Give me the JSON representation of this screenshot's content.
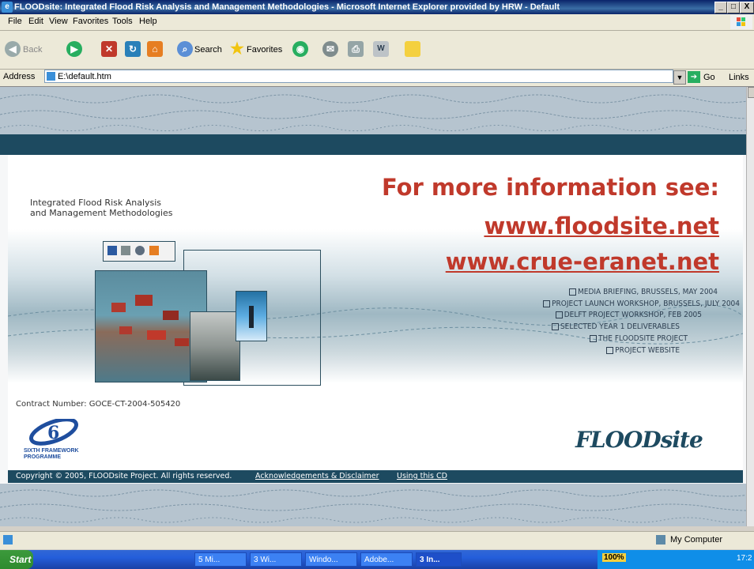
{
  "window": {
    "title": "FLOODsite: Integrated Flood Risk Analysis and Management Methodologies - Microsoft Internet Explorer provided by HRW - Default",
    "minimize": "_",
    "maximize": "□",
    "close": "X"
  },
  "menu": [
    "File",
    "Edit",
    "View",
    "Favorites",
    "Tools",
    "Help"
  ],
  "toolbar": {
    "back": "Back",
    "search": "Search",
    "favorites": "Favorites"
  },
  "address": {
    "label": "Address",
    "value": "E:\\default.htm",
    "go": "Go",
    "links": "Links"
  },
  "page": {
    "subtitle_line1": "Integrated Flood Risk Analysis",
    "subtitle_line2": "and Management Methodologies",
    "info_heading": "For more information see:",
    "link1": "www.floodsite.net",
    "link2": "www.crue-eranet.net",
    "nav_links": [
      "MEDIA BRIEFING, BRUSSELS, MAY 2004",
      "PROJECT LAUNCH WORKSHOP, BRUSSELS, JULY 2004",
      "DELFT PROJECT WORKSHOP, FEB 2005",
      "SELECTED YEAR 1 DELIVERABLES",
      "THE FLOODSITE PROJECT",
      "PROJECT WEBSITE"
    ],
    "contract": "Contract Number: GOCE-CT-2004-505420",
    "fp6_line1": "SIXTH FRAMEWORK",
    "fp6_line2": "PROGRAMME",
    "logo_flood": "FLOOD",
    "logo_site": "site",
    "copyright": "Copyright © 2005, FLOODsite Project. All rights reserved.",
    "ack_link": "Acknowledgements & Disclaimer",
    "cd_link": "Using this CD"
  },
  "status": {
    "zone": "My Computer"
  },
  "taskbar": {
    "start": "Start",
    "buttons": [
      "5 Mi...",
      "3 Wi...",
      "Windo...",
      "Adobe...",
      "3 In..."
    ],
    "zoom": "100%",
    "clock": "17:2"
  },
  "colors": {
    "accent_red": "#c0392b",
    "dark_teal": "#1d4a60",
    "titlebar": "#0a246a"
  }
}
